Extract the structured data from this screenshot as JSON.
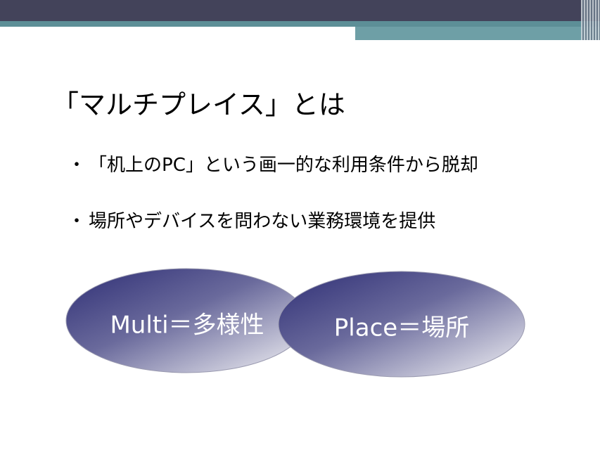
{
  "slide": {
    "title": "「マルチプレイス」とは",
    "bullets": [
      {
        "marker": "・",
        "text": "「机上のPC」という画一的な利用条件から脱却"
      },
      {
        "marker": "・",
        "text": "場所やデバイスを問わない業務環境を提供"
      }
    ],
    "ellipses": [
      {
        "label": "Multi＝多様性"
      },
      {
        "label": "Place＝場所"
      }
    ]
  },
  "colors": {
    "header_dark": "#43435a",
    "header_teal": "#5d8f97",
    "ellipse_dark": "#34347a",
    "ellipse_light": "#f2f2f4"
  }
}
